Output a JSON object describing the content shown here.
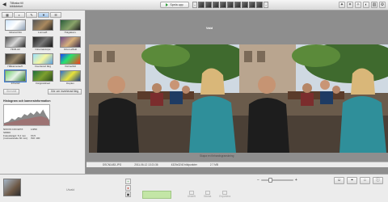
{
  "toolbar": {
    "back_line1": "Tillbaka till",
    "back_line2": "biblioteket",
    "play_label": "Spela upp",
    "thumb_prev": "‹",
    "thumb_next": "›",
    "icons": [
      "wand-icon",
      "crop-icon",
      "sparkle-icon",
      "color-icon",
      "compare-icon",
      "settings-icon"
    ]
  },
  "left_panel": {
    "tabs": [
      "▦",
      "◐",
      "✎",
      "▼",
      "☰"
    ],
    "effects": [
      {
        "label": "Infraröd film",
        "bg": "linear-gradient(135deg,#cfe6ff,#ffffff 50%,#8ea0b5)"
      },
      {
        "label": "Lomoeff.",
        "bg": "linear-gradient(135deg,#555,#a9895e 55%,#222)"
      },
      {
        "label": "Holgakam.",
        "bg": "linear-gradient(135deg,#2b5d3b,#8aa46a 55%,#222)"
      },
      {
        "label": "HDR-stil",
        "bg": "linear-gradient(135deg,#4d4d4d,#d8d8d8 50%,#2a2a2a)"
      },
      {
        "label": "Cinemascope",
        "bg": "linear-gradient(135deg,#1f1f1f,#777 50%,#141414)"
      },
      {
        "label": "Orton-effekt",
        "bg": "linear-gradient(135deg,#6f4b8a,#d7b07a 50%,#3d2e4a)"
      },
      {
        "label": "Hålkameraeff.",
        "bg": "linear-gradient(135deg,#333,#9a8a6d 50%,#1a1a1a)"
      },
      {
        "label": "Inverterad färg",
        "bg": "linear-gradient(135deg,#9be1ff,#f5f5a0 50%,#5aa0e0)"
      },
      {
        "label": "Värmebild",
        "bg": "linear-gradient(135deg,#1b3dff,#27e36f 40%,#ff3b1b)"
      },
      {
        "label": "Infraröd",
        "bg": "linear-gradient(135deg,#6fd06f,#e6f2e6 50%,#2d7a2d)"
      },
      {
        "label": "Färgmättnad",
        "bg": "linear-gradient(135deg,#1e6f3a,#7d9f2e 50%,#2a4a1e)"
      },
      {
        "label": "Duplex",
        "bg": "linear-gradient(135deg,#2d6fd0,#e7e23a 50%,#1f3f7f)"
      }
    ],
    "reset_label": "Återställ",
    "invert_label": "Gör om inverterad färg",
    "histogram_title": "Histogram och kamerainformation",
    "exif": [
      [
        "NIKON COOLPIX S8000",
        "1/250"
      ],
      [
        "Fokuslängd: 5.4 mm",
        "f/3.5"
      ],
      [
        "(motsvarande 30 mm)",
        "ISO 100"
      ]
    ]
  },
  "main": {
    "selected_label": "Vald",
    "hint": "Skapa en förhandsgranskning",
    "status": [
      "DSCN1483.JPG",
      "2011-06-12 13:21:36",
      "4320x3240 bildpunkter",
      "2.7 MB"
    ]
  },
  "bottom": {
    "sort_label": "Utvald",
    "actions": [
      "Utskrift",
      "Skicka",
      "Exportera"
    ],
    "zoom_minus": "−",
    "zoom_plus": "+",
    "zoom_level": 0.25,
    "right_icons": [
      "person-icon",
      "pin-icon",
      "tag-icon",
      "info-icon"
    ]
  },
  "colors": {
    "accent": "#3a7fd5",
    "play_green": "#2f9e3a",
    "save_green": "#c3e6a6"
  }
}
